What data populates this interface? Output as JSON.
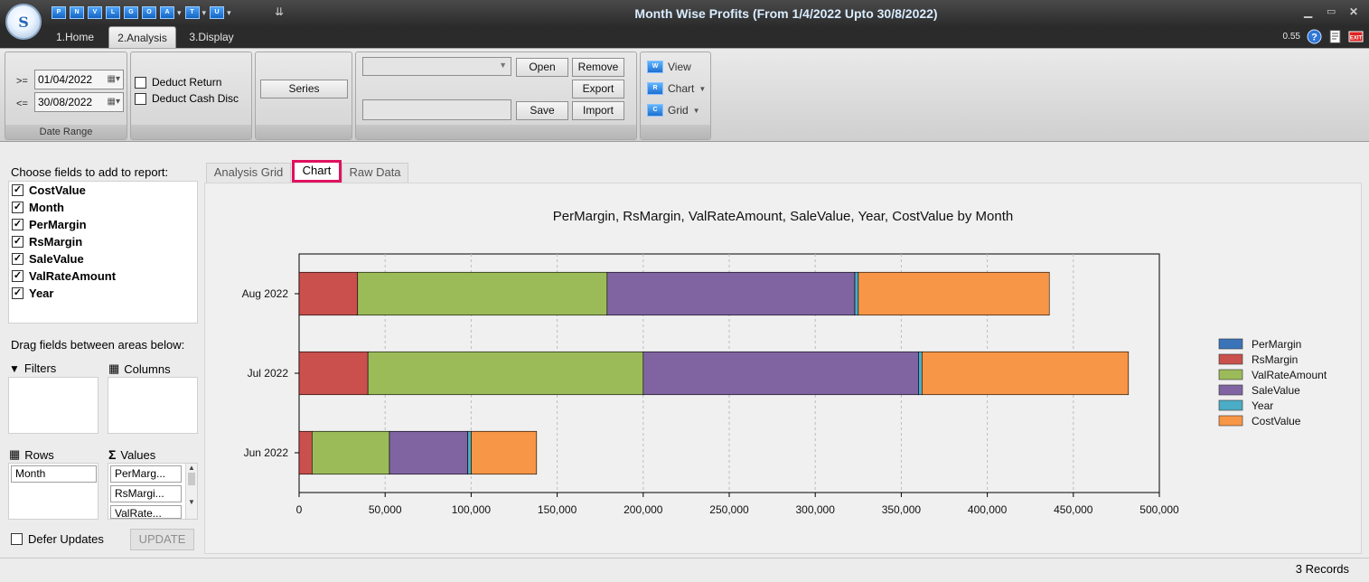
{
  "window": {
    "title": "Month Wise Profits (From 1/4/2022 Upto 30/8/2022)",
    "version": "0.55",
    "quick_access": [
      {
        "icon": "P",
        "dropdown": false
      },
      {
        "icon": "N",
        "dropdown": false
      },
      {
        "icon": "V",
        "dropdown": false
      },
      {
        "icon": "L",
        "dropdown": false
      },
      {
        "icon": "G",
        "dropdown": false
      },
      {
        "icon": "O",
        "dropdown": false
      },
      {
        "icon": "A",
        "dropdown": true
      },
      {
        "icon": "T",
        "dropdown": true
      },
      {
        "icon": "U",
        "dropdown": true
      }
    ]
  },
  "tabs": [
    "1.Home",
    "2.Analysis",
    "3.Display"
  ],
  "active_tab": "2.Analysis",
  "ribbon": {
    "date_range": {
      "from_op": ">=",
      "from_value": "01/04/2022",
      "to_op": "<=",
      "to_value": "30/08/2022",
      "label": "Date Range"
    },
    "options": {
      "deduct_return": "Deduct Return",
      "deduct_return_checked": false,
      "deduct_cash_disc": "Deduct Cash Disc",
      "deduct_cash_disc_checked": false
    },
    "series_button": "Series",
    "layout": {
      "combo_value": "",
      "name_value": "",
      "open": "Open",
      "remove": "Remove",
      "export": "Export",
      "save": "Save",
      "import": "Import"
    },
    "view": {
      "view": "View",
      "chart": "Chart",
      "grid": "Grid"
    }
  },
  "field_list": {
    "title": "Choose fields to add to report:",
    "fields": [
      {
        "name": "CostValue",
        "checked": true
      },
      {
        "name": "Month",
        "checked": true
      },
      {
        "name": "PerMargin",
        "checked": true
      },
      {
        "name": "RsMargin",
        "checked": true
      },
      {
        "name": "SaleValue",
        "checked": true
      },
      {
        "name": "ValRateAmount",
        "checked": true
      },
      {
        "name": "Year",
        "checked": true
      }
    ],
    "drag_hint": "Drag fields between areas below:",
    "filters_label": "Filters",
    "columns_label": "Columns",
    "rows_label": "Rows",
    "values_label": "Values",
    "rows_items": [
      "Month"
    ],
    "values_items": [
      "PerMarg...",
      "RsMargi...",
      "ValRate..."
    ],
    "defer_updates": "Defer Updates",
    "update_button": "UPDATE"
  },
  "chart_tabs": [
    "Analysis Grid",
    "Chart",
    "Raw Data"
  ],
  "active_chart_tab": "Chart",
  "status": {
    "records": "3 Records"
  },
  "chart_data": {
    "type": "bar",
    "orientation": "horizontal",
    "stacked": true,
    "title": "PerMargin, RsMargin, ValRateAmount, SaleValue, Year, CostValue by Month",
    "categories": [
      "Jun 2022",
      "Jul 2022",
      "Aug 2022"
    ],
    "series": [
      {
        "name": "PerMargin",
        "color": "#3b73b9",
        "values": [
          8,
          9,
          9
        ]
      },
      {
        "name": "RsMargin",
        "color": "#c9504c",
        "values": [
          7500,
          40000,
          34000
        ]
      },
      {
        "name": "ValRateAmount",
        "color": "#9bbb59",
        "values": [
          45000,
          160000,
          145000
        ]
      },
      {
        "name": "SaleValue",
        "color": "#8064a2",
        "values": [
          45500,
          160000,
          144000
        ]
      },
      {
        "name": "Year",
        "color": "#4bacc6",
        "values": [
          2022,
          2022,
          2022
        ]
      },
      {
        "name": "CostValue",
        "color": "#f79646",
        "values": [
          38000,
          120000,
          111000
        ]
      }
    ],
    "xlim": [
      0,
      500000
    ],
    "xticks": [
      "0",
      "50,000",
      "100,000",
      "150,000",
      "200,000",
      "250,000",
      "300,000",
      "350,000",
      "400,000",
      "450,000",
      "500,000"
    ],
    "tick_step": 50000,
    "grid": true,
    "legend": "right"
  }
}
